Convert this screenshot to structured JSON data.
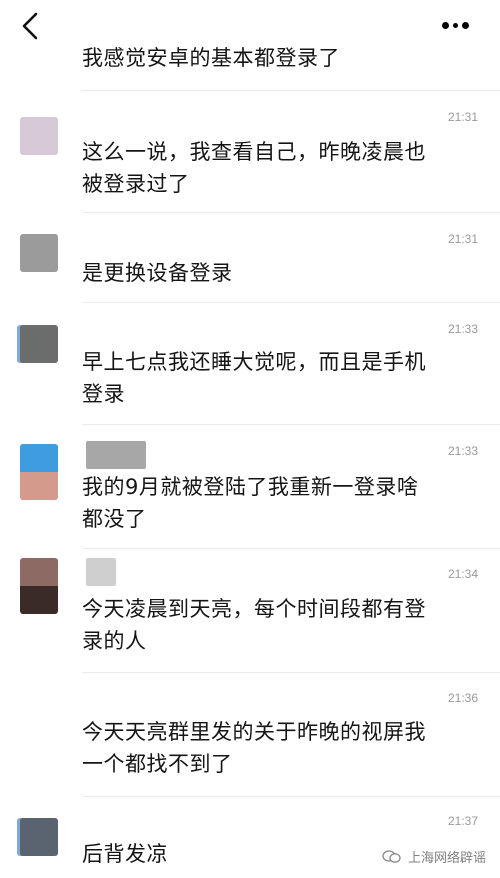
{
  "messages": [
    {
      "text": "我感觉安卓的基本都登录了",
      "time": ""
    },
    {
      "text": "这么一说，我查看自己，昨晚凌晨也\n被登录过了",
      "time": "21:31"
    },
    {
      "text": "是更换设备登录",
      "time": "21:31"
    },
    {
      "text": "早上七点我还睡大觉呢，而且是手机\n登录",
      "time": "21:33"
    },
    {
      "text": "我的9月就被登陆了我重新一登录啥\n都没了",
      "time": "21:33"
    },
    {
      "text": "今天凌晨到天亮，每个时间段都有登\n录的人",
      "time": "21:34"
    },
    {
      "text": "今天天亮群里发的关于昨晚的视屏我\n一个都找不到了",
      "time": "21:36"
    },
    {
      "text": "后背发凉",
      "time": "21:37"
    }
  ],
  "watermark": {
    "text": "上海网络辟谣"
  }
}
